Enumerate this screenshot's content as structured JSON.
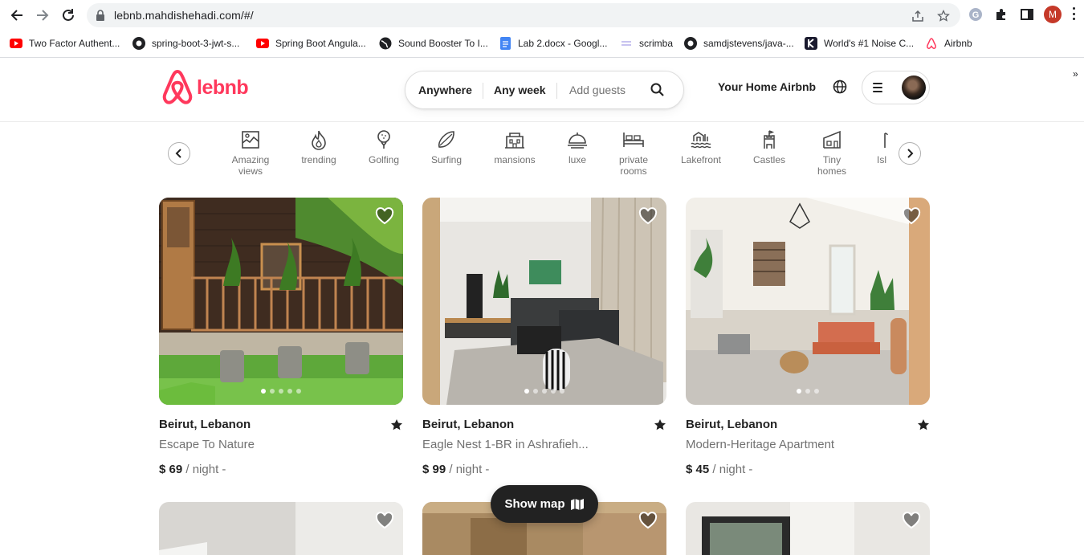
{
  "browser": {
    "url": "lebnb.mahdishehadi.com/#/",
    "profile_initial": "M",
    "bookmarks": [
      {
        "label": "Two Factor Authent...",
        "icon": "youtube-icon"
      },
      {
        "label": "spring-boot-3-jwt-s...",
        "icon": "github-icon"
      },
      {
        "label": "Spring Boot Angula...",
        "icon": "youtube-icon"
      },
      {
        "label": "Sound Booster To I...",
        "icon": "globe-icon"
      },
      {
        "label": "Lab 2.docx - Googl...",
        "icon": "docs-icon"
      },
      {
        "label": "scrimba",
        "icon": "scrimba-icon"
      },
      {
        "label": "samdjstevens/java-...",
        "icon": "github-icon"
      },
      {
        "label": "World's #1 Noise C...",
        "icon": "krisp-icon"
      },
      {
        "label": "Airbnb",
        "icon": "airbnb-icon"
      }
    ],
    "more": "»"
  },
  "header": {
    "logo_text": "lebnb",
    "search": {
      "where": "Anywhere",
      "when": "Any week",
      "guests_placeholder": "Add guests"
    },
    "host_link": "Your Home Airbnb"
  },
  "categories": [
    {
      "label": "Amazing\nviews",
      "icon": "amazing-views-icon"
    },
    {
      "label": "trending",
      "icon": "flame-icon"
    },
    {
      "label": "Golfing",
      "icon": "golf-icon"
    },
    {
      "label": "Surfing",
      "icon": "surfboard-icon"
    },
    {
      "label": "mansions",
      "icon": "mansion-icon"
    },
    {
      "label": "luxe",
      "icon": "cloche-icon"
    },
    {
      "label": "private\nrooms",
      "icon": "bed-icon"
    },
    {
      "label": "Lakefront",
      "icon": "lakefront-icon"
    },
    {
      "label": "Castles",
      "icon": "castle-icon"
    },
    {
      "label": "Tiny\nhomes",
      "icon": "tiny-home-icon"
    },
    {
      "label": "Isl",
      "icon": "island-icon"
    }
  ],
  "listings": [
    {
      "location": "Beirut, Lebanon",
      "title": "Escape To Nature",
      "price": "$ 69",
      "price_suffix": " / night -"
    },
    {
      "location": "Beirut, Lebanon",
      "title": "Eagle Nest 1-BR in Ashrafieh...",
      "price": "$ 99",
      "price_suffix": " / night -"
    },
    {
      "location": "Beirut, Lebanon",
      "title": "Modern-Heritage Apartment",
      "price": "$ 45",
      "price_suffix": " / night -"
    }
  ],
  "show_map_label": "Show map",
  "colors": {
    "brand": "#ff385c",
    "text": "#222222",
    "muted": "#717171"
  }
}
